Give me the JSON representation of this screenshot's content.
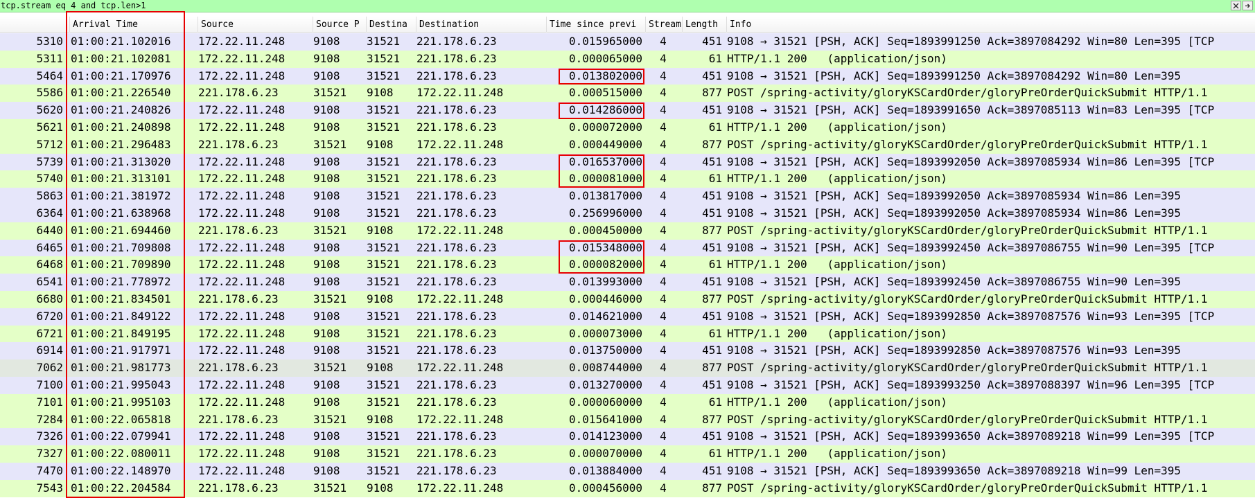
{
  "filter": {
    "value": "tcp.stream eq 4 and tcp.len>1",
    "clear_icon": "close-icon",
    "apply_icon": "arrow-right-icon"
  },
  "columns": {
    "no": "",
    "arrival": "Arrival Time",
    "source": "Source",
    "sport": "Source P",
    "dport": "Destina",
    "dest": "Destination",
    "delta": "Time since previ",
    "stream": "Stream",
    "length": "Length",
    "info": "Info"
  },
  "colors": {
    "filter_bg": "#afffaf",
    "tcp_row": "#e6e6fa",
    "http_row": "#e4ffc7",
    "highlight_box": "#e60000"
  },
  "packets": [
    {
      "no": "5310",
      "time": "01:00:21.102016",
      "src": "172.22.11.248",
      "sport": "9108",
      "dport": "31521",
      "dst": "221.178.6.23",
      "delta": "0.015965000",
      "stream": "4",
      "len": "451",
      "info": "9108 → 31521 [PSH, ACK] Seq=1893991250 Ack=3897084292 Win=80 Len=395 [TCP",
      "kind": "tcp",
      "marked": false
    },
    {
      "no": "5311",
      "time": "01:00:21.102081",
      "src": "172.22.11.248",
      "sport": "9108",
      "dport": "31521",
      "dst": "221.178.6.23",
      "delta": "0.000065000",
      "stream": "4",
      "len": "61",
      "info": "HTTP/1.1 200   (application/json)",
      "kind": "http",
      "marked": false
    },
    {
      "no": "5464",
      "time": "01:00:21.170976",
      "src": "172.22.11.248",
      "sport": "9108",
      "dport": "31521",
      "dst": "221.178.6.23",
      "delta": "0.013802000",
      "stream": "4",
      "len": "451",
      "info": "9108 → 31521 [PSH, ACK] Seq=1893991250 Ack=3897084292 Win=80 Len=395",
      "kind": "tcp",
      "marked": true
    },
    {
      "no": "5586",
      "time": "01:00:21.226540",
      "src": "221.178.6.23",
      "sport": "31521",
      "dport": "9108",
      "dst": "172.22.11.248",
      "delta": "0.000515000",
      "stream": "4",
      "len": "877",
      "info": "POST /spring-activity/gloryKSCardOrder/gloryPreOrderQuickSubmit HTTP/1.1",
      "kind": "http",
      "marked": false
    },
    {
      "no": "5620",
      "time": "01:00:21.240826",
      "src": "172.22.11.248",
      "sport": "9108",
      "dport": "31521",
      "dst": "221.178.6.23",
      "delta": "0.014286000",
      "stream": "4",
      "len": "451",
      "info": "9108 → 31521 [PSH, ACK] Seq=1893991650 Ack=3897085113 Win=83 Len=395 [TCP",
      "kind": "tcp",
      "marked": true
    },
    {
      "no": "5621",
      "time": "01:00:21.240898",
      "src": "172.22.11.248",
      "sport": "9108",
      "dport": "31521",
      "dst": "221.178.6.23",
      "delta": "0.000072000",
      "stream": "4",
      "len": "61",
      "info": "HTTP/1.1 200   (application/json)",
      "kind": "http",
      "marked": false
    },
    {
      "no": "5712",
      "time": "01:00:21.296483",
      "src": "221.178.6.23",
      "sport": "31521",
      "dport": "9108",
      "dst": "172.22.11.248",
      "delta": "0.000449000",
      "stream": "4",
      "len": "877",
      "info": "POST /spring-activity/gloryKSCardOrder/gloryPreOrderQuickSubmit HTTP/1.1",
      "kind": "http",
      "marked": false
    },
    {
      "no": "5739",
      "time": "01:00:21.313020",
      "src": "172.22.11.248",
      "sport": "9108",
      "dport": "31521",
      "dst": "221.178.6.23",
      "delta": "0.016537000",
      "stream": "4",
      "len": "451",
      "info": "9108 → 31521 [PSH, ACK] Seq=1893992050 Ack=3897085934 Win=86 Len=395 [TCP",
      "kind": "tcp",
      "marked": true
    },
    {
      "no": "5740",
      "time": "01:00:21.313101",
      "src": "172.22.11.248",
      "sport": "9108",
      "dport": "31521",
      "dst": "221.178.6.23",
      "delta": "0.000081000",
      "stream": "4",
      "len": "61",
      "info": "HTTP/1.1 200   (application/json)",
      "kind": "http",
      "marked": true
    },
    {
      "no": "5863",
      "time": "01:00:21.381972",
      "src": "172.22.11.248",
      "sport": "9108",
      "dport": "31521",
      "dst": "221.178.6.23",
      "delta": "0.013817000",
      "stream": "4",
      "len": "451",
      "info": "9108 → 31521 [PSH, ACK] Seq=1893992050 Ack=3897085934 Win=86 Len=395",
      "kind": "tcp",
      "marked": false
    },
    {
      "no": "6364",
      "time": "01:00:21.638968",
      "src": "172.22.11.248",
      "sport": "9108",
      "dport": "31521",
      "dst": "221.178.6.23",
      "delta": "0.256996000",
      "stream": "4",
      "len": "451",
      "info": "9108 → 31521 [PSH, ACK] Seq=1893992050 Ack=3897085934 Win=86 Len=395",
      "kind": "tcp",
      "marked": false
    },
    {
      "no": "6440",
      "time": "01:00:21.694460",
      "src": "221.178.6.23",
      "sport": "31521",
      "dport": "9108",
      "dst": "172.22.11.248",
      "delta": "0.000450000",
      "stream": "4",
      "len": "877",
      "info": "POST /spring-activity/gloryKSCardOrder/gloryPreOrderQuickSubmit HTTP/1.1",
      "kind": "http",
      "marked": false
    },
    {
      "no": "6465",
      "time": "01:00:21.709808",
      "src": "172.22.11.248",
      "sport": "9108",
      "dport": "31521",
      "dst": "221.178.6.23",
      "delta": "0.015348000",
      "stream": "4",
      "len": "451",
      "info": "9108 → 31521 [PSH, ACK] Seq=1893992450 Ack=3897086755 Win=90 Len=395 [TCP",
      "kind": "tcp",
      "marked": true
    },
    {
      "no": "6468",
      "time": "01:00:21.709890",
      "src": "172.22.11.248",
      "sport": "9108",
      "dport": "31521",
      "dst": "221.178.6.23",
      "delta": "0.000082000",
      "stream": "4",
      "len": "61",
      "info": "HTTP/1.1 200   (application/json)",
      "kind": "http",
      "marked": true
    },
    {
      "no": "6541",
      "time": "01:00:21.778972",
      "src": "172.22.11.248",
      "sport": "9108",
      "dport": "31521",
      "dst": "221.178.6.23",
      "delta": "0.013993000",
      "stream": "4",
      "len": "451",
      "info": "9108 → 31521 [PSH, ACK] Seq=1893992450 Ack=3897086755 Win=90 Len=395",
      "kind": "tcp",
      "marked": false
    },
    {
      "no": "6680",
      "time": "01:00:21.834501",
      "src": "221.178.6.23",
      "sport": "31521",
      "dport": "9108",
      "dst": "172.22.11.248",
      "delta": "0.000446000",
      "stream": "4",
      "len": "877",
      "info": "POST /spring-activity/gloryKSCardOrder/gloryPreOrderQuickSubmit HTTP/1.1",
      "kind": "http",
      "marked": false
    },
    {
      "no": "6720",
      "time": "01:00:21.849122",
      "src": "172.22.11.248",
      "sport": "9108",
      "dport": "31521",
      "dst": "221.178.6.23",
      "delta": "0.014621000",
      "stream": "4",
      "len": "451",
      "info": "9108 → 31521 [PSH, ACK] Seq=1893992850 Ack=3897087576 Win=93 Len=395 [TCP",
      "kind": "tcp",
      "marked": false
    },
    {
      "no": "6721",
      "time": "01:00:21.849195",
      "src": "172.22.11.248",
      "sport": "9108",
      "dport": "31521",
      "dst": "221.178.6.23",
      "delta": "0.000073000",
      "stream": "4",
      "len": "61",
      "info": "HTTP/1.1 200   (application/json)",
      "kind": "http",
      "marked": false
    },
    {
      "no": "6914",
      "time": "01:00:21.917971",
      "src": "172.22.11.248",
      "sport": "9108",
      "dport": "31521",
      "dst": "221.178.6.23",
      "delta": "0.013750000",
      "stream": "4",
      "len": "451",
      "info": "9108 → 31521 [PSH, ACK] Seq=1893992850 Ack=3897087576 Win=93 Len=395",
      "kind": "tcp",
      "marked": false
    },
    {
      "no": "7062",
      "time": "01:00:21.981773",
      "src": "221.178.6.23",
      "sport": "31521",
      "dport": "9108",
      "dst": "172.22.11.248",
      "delta": "0.008744000",
      "stream": "4",
      "len": "877",
      "info": "POST /spring-activity/gloryKSCardOrder/gloryPreOrderQuickSubmit HTTP/1.1",
      "kind": "sel",
      "marked": false
    },
    {
      "no": "7100",
      "time": "01:00:21.995043",
      "src": "172.22.11.248",
      "sport": "9108",
      "dport": "31521",
      "dst": "221.178.6.23",
      "delta": "0.013270000",
      "stream": "4",
      "len": "451",
      "info": "9108 → 31521 [PSH, ACK] Seq=1893993250 Ack=3897088397 Win=96 Len=395 [TCP",
      "kind": "tcp",
      "marked": false
    },
    {
      "no": "7101",
      "time": "01:00:21.995103",
      "src": "172.22.11.248",
      "sport": "9108",
      "dport": "31521",
      "dst": "221.178.6.23",
      "delta": "0.000060000",
      "stream": "4",
      "len": "61",
      "info": "HTTP/1.1 200   (application/json)",
      "kind": "http",
      "marked": false
    },
    {
      "no": "7284",
      "time": "01:00:22.065818",
      "src": "221.178.6.23",
      "sport": "31521",
      "dport": "9108",
      "dst": "172.22.11.248",
      "delta": "0.015641000",
      "stream": "4",
      "len": "877",
      "info": "POST /spring-activity/gloryKSCardOrder/gloryPreOrderQuickSubmit HTTP/1.1",
      "kind": "http",
      "marked": false
    },
    {
      "no": "7326",
      "time": "01:00:22.079941",
      "src": "172.22.11.248",
      "sport": "9108",
      "dport": "31521",
      "dst": "221.178.6.23",
      "delta": "0.014123000",
      "stream": "4",
      "len": "451",
      "info": "9108 → 31521 [PSH, ACK] Seq=1893993650 Ack=3897089218 Win=99 Len=395 [TCP",
      "kind": "tcp",
      "marked": false
    },
    {
      "no": "7327",
      "time": "01:00:22.080011",
      "src": "172.22.11.248",
      "sport": "9108",
      "dport": "31521",
      "dst": "221.178.6.23",
      "delta": "0.000070000",
      "stream": "4",
      "len": "61",
      "info": "HTTP/1.1 200   (application/json)",
      "kind": "http",
      "marked": false
    },
    {
      "no": "7470",
      "time": "01:00:22.148970",
      "src": "172.22.11.248",
      "sport": "9108",
      "dport": "31521",
      "dst": "221.178.6.23",
      "delta": "0.013884000",
      "stream": "4",
      "len": "451",
      "info": "9108 → 31521 [PSH, ACK] Seq=1893993650 Ack=3897089218 Win=99 Len=395",
      "kind": "tcp",
      "marked": false
    },
    {
      "no": "7543",
      "time": "01:00:22.204584",
      "src": "221.178.6.23",
      "sport": "31521",
      "dport": "9108",
      "dst": "172.22.11.248",
      "delta": "0.000456000",
      "stream": "4",
      "len": "877",
      "info": "POST /spring-activity/gloryKSCardOrder/gloryPreOrderQuickSubmit HTTP/1.1",
      "kind": "http",
      "marked": false
    }
  ]
}
